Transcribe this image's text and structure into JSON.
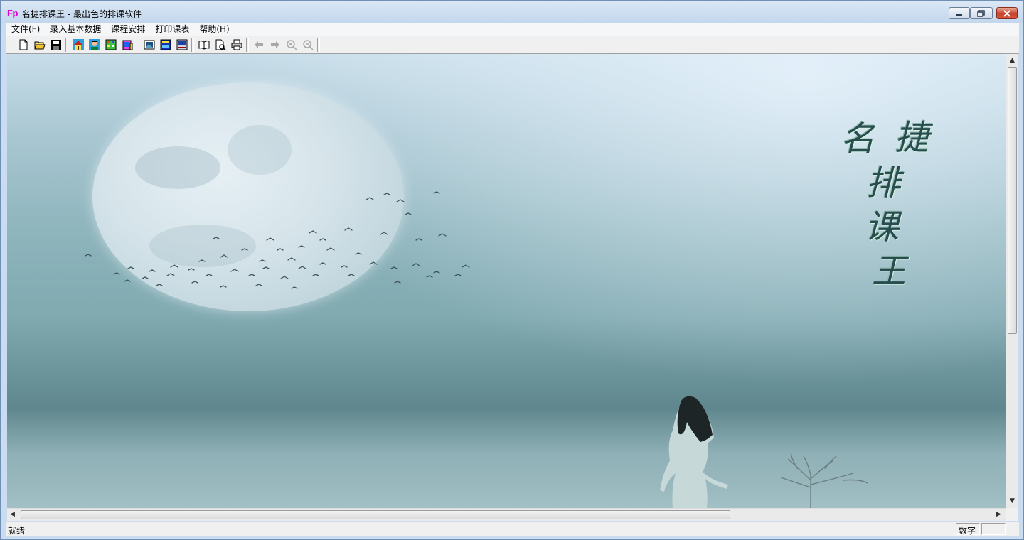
{
  "window": {
    "app_icon_text": "Fp",
    "title": "名捷排课王 - 最出色的排课软件"
  },
  "menu": [
    {
      "label": "文件(F)"
    },
    {
      "label": "录入基本数据"
    },
    {
      "label": "课程安排"
    },
    {
      "label": "打印课表"
    },
    {
      "label": "帮助(H)"
    }
  ],
  "toolbar": {
    "groups": [
      [
        "new-file-icon",
        "open-folder-icon",
        "save-disk-icon"
      ],
      [
        "home-icon",
        "teacher-icon",
        "class-table-icon",
        "course-book-icon"
      ],
      [
        "schedule-view-icon",
        "timetable-icon",
        "monitor-table-icon"
      ],
      [
        "open-book-icon",
        "print-preview-icon",
        "printer-icon"
      ],
      [
        "arrow-left-icon",
        "arrow-right-icon",
        "zoom-in-icon",
        "zoom-out-icon"
      ]
    ]
  },
  "splash": {
    "calligraphy": [
      "名",
      "捷",
      "排",
      "课",
      "王"
    ]
  },
  "status": {
    "text": "就绪",
    "mode": "数字"
  },
  "colors": {
    "title_bar": "#c9dcf0",
    "close_button": "#c7452c",
    "app_icon_magenta": "#e000d0"
  }
}
